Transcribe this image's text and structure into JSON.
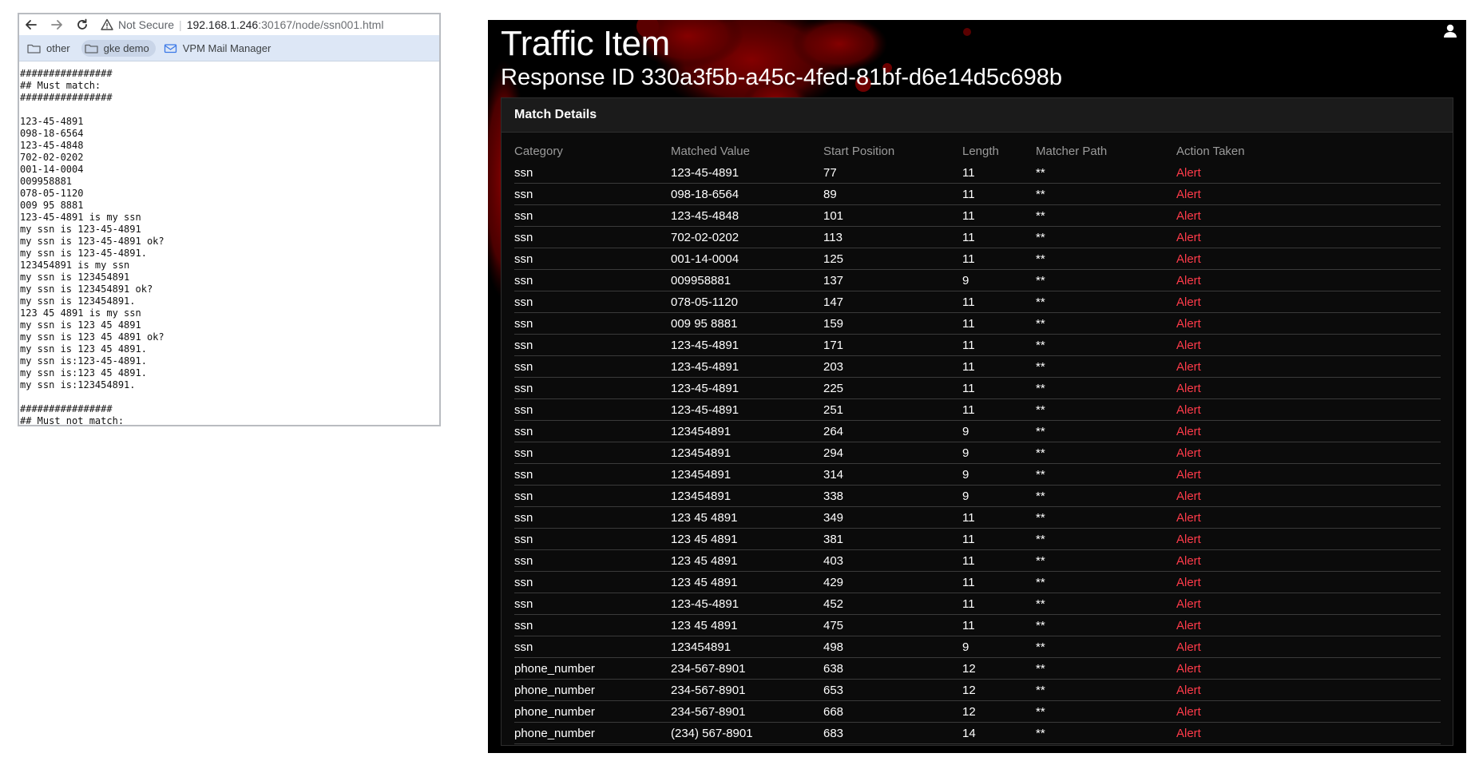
{
  "browser": {
    "security_label": "Not Secure",
    "url_host": "192.168.1.246",
    "url_path": ":30167/node/ssn001.html",
    "bookmarks": [
      {
        "label": "other",
        "icon": "folder-icon"
      },
      {
        "label": "gke demo",
        "icon": "folder-icon"
      },
      {
        "label": "VPM Mail Manager",
        "icon": "mail-icon"
      }
    ],
    "page_lines": [
      "################",
      "## Must match:",
      "################",
      "",
      "123-45-4891",
      "098-18-6564",
      "123-45-4848",
      "702-02-0202",
      "001-14-0004",
      "009958881",
      "078-05-1120",
      "009 95 8881",
      "123-45-4891 is my ssn",
      "my ssn is 123-45-4891",
      "my ssn is 123-45-4891 ok?",
      "my ssn is 123-45-4891.",
      "123454891 is my ssn",
      "my ssn is 123454891",
      "my ssn is 123454891 ok?",
      "my ssn is 123454891.",
      "123 45 4891 is my ssn",
      "my ssn is 123 45 4891",
      "my ssn is 123 45 4891 ok?",
      "my ssn is 123 45 4891.",
      "my ssn is:123-45-4891.",
      "my ssn is:123 45 4891.",
      "my ssn is:123454891.",
      "",
      "################",
      "## Must not match:"
    ]
  },
  "panel": {
    "title": "Traffic Item",
    "subtitle": "Response ID 330a3f5b-a45c-4fed-81bf-d6e14d5c698b",
    "card_title": "Match Details",
    "columns": [
      "Category",
      "Matched Value",
      "Start Position",
      "Length",
      "Matcher Path",
      "Action Taken"
    ],
    "rows": [
      [
        "ssn",
        "123-45-4891",
        "77",
        "11",
        "**",
        "Alert"
      ],
      [
        "ssn",
        "098-18-6564",
        "89",
        "11",
        "**",
        "Alert"
      ],
      [
        "ssn",
        "123-45-4848",
        "101",
        "11",
        "**",
        "Alert"
      ],
      [
        "ssn",
        "702-02-0202",
        "113",
        "11",
        "**",
        "Alert"
      ],
      [
        "ssn",
        "001-14-0004",
        "125",
        "11",
        "**",
        "Alert"
      ],
      [
        "ssn",
        "009958881",
        "137",
        "9",
        "**",
        "Alert"
      ],
      [
        "ssn",
        "078-05-1120",
        "147",
        "11",
        "**",
        "Alert"
      ],
      [
        "ssn",
        "009 95 8881",
        "159",
        "11",
        "**",
        "Alert"
      ],
      [
        "ssn",
        "123-45-4891",
        "171",
        "11",
        "**",
        "Alert"
      ],
      [
        "ssn",
        "123-45-4891",
        "203",
        "11",
        "**",
        "Alert"
      ],
      [
        "ssn",
        "123-45-4891",
        "225",
        "11",
        "**",
        "Alert"
      ],
      [
        "ssn",
        "123-45-4891",
        "251",
        "11",
        "**",
        "Alert"
      ],
      [
        "ssn",
        "123454891",
        "264",
        "9",
        "**",
        "Alert"
      ],
      [
        "ssn",
        "123454891",
        "294",
        "9",
        "**",
        "Alert"
      ],
      [
        "ssn",
        "123454891",
        "314",
        "9",
        "**",
        "Alert"
      ],
      [
        "ssn",
        "123454891",
        "338",
        "9",
        "**",
        "Alert"
      ],
      [
        "ssn",
        "123 45 4891",
        "349",
        "11",
        "**",
        "Alert"
      ],
      [
        "ssn",
        "123 45 4891",
        "381",
        "11",
        "**",
        "Alert"
      ],
      [
        "ssn",
        "123 45 4891",
        "403",
        "11",
        "**",
        "Alert"
      ],
      [
        "ssn",
        "123 45 4891",
        "429",
        "11",
        "**",
        "Alert"
      ],
      [
        "ssn",
        "123-45-4891",
        "452",
        "11",
        "**",
        "Alert"
      ],
      [
        "ssn",
        "123 45 4891",
        "475",
        "11",
        "**",
        "Alert"
      ],
      [
        "ssn",
        "123454891",
        "498",
        "9",
        "**",
        "Alert"
      ],
      [
        "phone_number",
        "234-567-8901",
        "638",
        "12",
        "**",
        "Alert"
      ],
      [
        "phone_number",
        "234-567-8901",
        "653",
        "12",
        "**",
        "Alert"
      ],
      [
        "phone_number",
        "234-567-8901",
        "668",
        "12",
        "**",
        "Alert"
      ],
      [
        "phone_number",
        "(234) 567-8901",
        "683",
        "14",
        "**",
        "Alert"
      ]
    ]
  },
  "colors": {
    "alert": "#ff3b4a",
    "panel_bg": "#000000",
    "bookmarks_bar": "#dde7f6",
    "blood_splatter": "#7a0000"
  }
}
